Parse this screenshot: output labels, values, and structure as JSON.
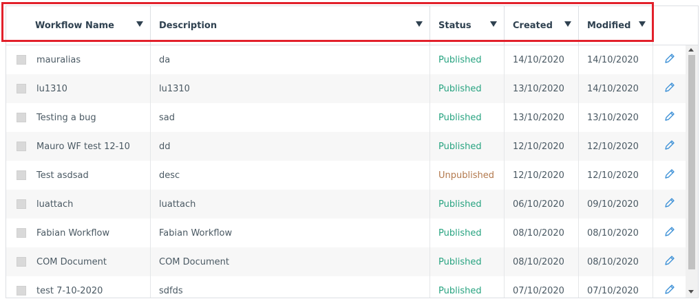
{
  "columns": [
    {
      "label": "Workflow Name"
    },
    {
      "label": "Description"
    },
    {
      "label": "Status"
    },
    {
      "label": "Created"
    },
    {
      "label": "Modified"
    }
  ],
  "rows": [
    {
      "name": "mauralias",
      "description": "da",
      "status": "Published",
      "created": "14/10/2020",
      "modified": "14/10/2020"
    },
    {
      "name": "lu1310",
      "description": "lu1310",
      "status": "Published",
      "created": "13/10/2020",
      "modified": "14/10/2020"
    },
    {
      "name": "Testing a bug",
      "description": "sad",
      "status": "Published",
      "created": "13/10/2020",
      "modified": "13/10/2020"
    },
    {
      "name": "Mauro WF test 12-10",
      "description": "dd",
      "status": "Published",
      "created": "12/10/2020",
      "modified": "12/10/2020"
    },
    {
      "name": "Test asdsad",
      "description": "desc",
      "status": "Unpublished",
      "created": "12/10/2020",
      "modified": "12/10/2020"
    },
    {
      "name": "luattach",
      "description": "luattach",
      "status": "Published",
      "created": "06/10/2020",
      "modified": "09/10/2020"
    },
    {
      "name": "Fabian Workflow",
      "description": "Fabian Workflow",
      "status": "Published",
      "created": "08/10/2020",
      "modified": "08/10/2020"
    },
    {
      "name": "COM Document",
      "description": "COM Document",
      "status": "Published",
      "created": "08/10/2020",
      "modified": "08/10/2020"
    },
    {
      "name": "test 7-10-2020",
      "description": "sdfds",
      "status": "Published",
      "created": "07/10/2020",
      "modified": "07/10/2020"
    }
  ],
  "colors": {
    "published": "#27a380",
    "unpublished": "#b2784c",
    "highlight": "#e2202a",
    "edit_icon": "#3a8fd6"
  },
  "icons": {
    "sort": "caret-down-icon",
    "edit": "pencil-icon",
    "checkbox": "checkbox-icon"
  }
}
